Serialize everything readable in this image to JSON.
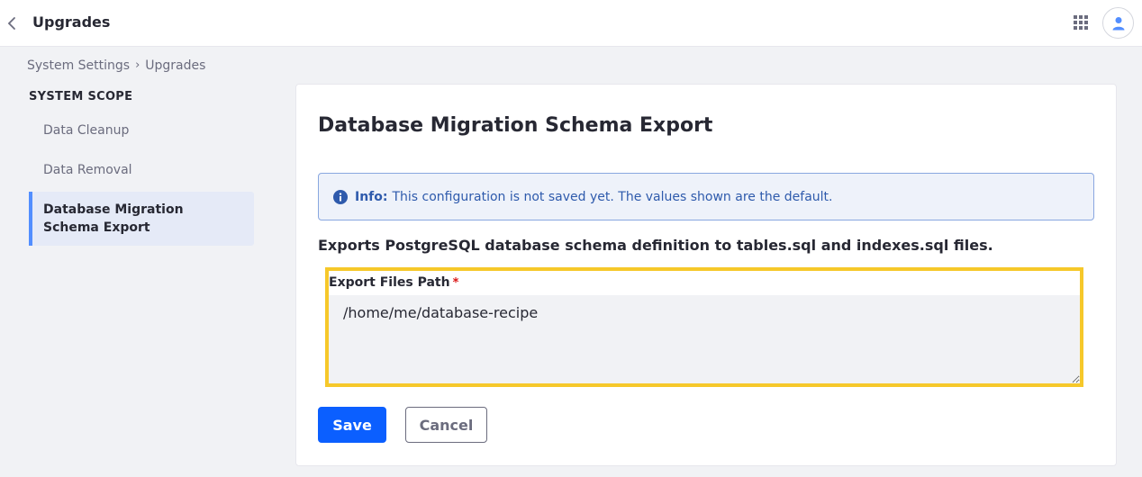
{
  "header": {
    "title": "Upgrades",
    "back_icon": "chevron-left-icon",
    "apps_icon": "grid-icon",
    "user_icon": "user-icon"
  },
  "breadcrumb": {
    "items": [
      "System Settings",
      "Upgrades"
    ]
  },
  "sidebar": {
    "heading": "SYSTEM SCOPE",
    "items": [
      {
        "label": "Data Cleanup"
      },
      {
        "label": "Data Removal"
      },
      {
        "label": "Database Migration Schema Export"
      }
    ]
  },
  "main": {
    "title": "Database Migration Schema Export",
    "alert": {
      "label": "Info:",
      "text": "This configuration is not saved yet. The values shown are the default."
    },
    "description": "Exports PostgreSQL database schema definition to tables.sql and indexes.sql files.",
    "field": {
      "label": "Export Files Path",
      "required_mark": "*",
      "value": "/home/me/database-recipe"
    },
    "save_label": "Save",
    "cancel_label": "Cancel"
  },
  "colors": {
    "primary": "#0b5fff",
    "alert_bg": "#eef2fa",
    "alert_text": "#2e5aac",
    "highlight": "#f6c82a",
    "active_nav_bg": "#e5eaf7",
    "active_nav_accent": "#528eff"
  }
}
